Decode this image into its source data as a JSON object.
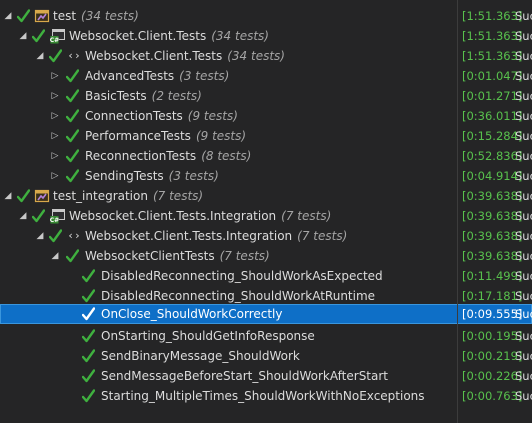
{
  "colors": {
    "background": "#252526",
    "selection": "#0e6fc7",
    "pass_green": "#3fb03f",
    "duration_green": "#58c14d",
    "text": "#dcdcdc",
    "count_text": "#a5a5a5"
  },
  "rows": [
    {
      "arrow": "expanded",
      "icon": "test-project-icon",
      "name": "test",
      "count": "(34 tests)",
      "duration": "[1:51.363]",
      "result": "Suc"
    },
    {
      "arrow": "expanded",
      "icon": "csharp-project-icon",
      "name": "Websocket.Client.Tests",
      "count": "(34 tests)",
      "duration": "[1:51.363]",
      "result": "Suc"
    },
    {
      "arrow": "expanded",
      "icon": "namespace-icon",
      "name": "Websocket.Client.Tests",
      "count": "(34 tests)",
      "duration": "[1:51.363]",
      "result": "Suc"
    },
    {
      "arrow": "collapsed",
      "icon": null,
      "name": "AdvancedTests",
      "count": "(3 tests)",
      "duration": "[0:01.047]",
      "result": "Suc"
    },
    {
      "arrow": "collapsed",
      "icon": null,
      "name": "BasicTests",
      "count": "(2 tests)",
      "duration": "[0:01.271]",
      "result": "Suc"
    },
    {
      "arrow": "collapsed",
      "icon": null,
      "name": "ConnectionTests",
      "count": "(9 tests)",
      "duration": "[0:36.011]",
      "result": "Suc"
    },
    {
      "arrow": "collapsed",
      "icon": null,
      "name": "PerformanceTests",
      "count": "(9 tests)",
      "duration": "[0:15.284]",
      "result": "Suc"
    },
    {
      "arrow": "collapsed",
      "icon": null,
      "name": "ReconnectionTests",
      "count": "(8 tests)",
      "duration": "[0:52.836]",
      "result": "Suc"
    },
    {
      "arrow": "collapsed",
      "icon": null,
      "name": "SendingTests",
      "count": "(3 tests)",
      "duration": "[0:04.914]",
      "result": "Suc"
    },
    {
      "arrow": "expanded",
      "icon": "test-project-icon",
      "name": "test_integration",
      "count": "(7 tests)",
      "duration": "[0:39.638]",
      "result": "Suc"
    },
    {
      "arrow": "expanded",
      "icon": "csharp-project-icon",
      "name": "Websocket.Client.Tests.Integration",
      "count": "(7 tests)",
      "duration": "[0:39.638]",
      "result": "Suc"
    },
    {
      "arrow": "expanded",
      "icon": "namespace-icon",
      "name": "Websocket.Client.Tests.Integration",
      "count": "(7 tests)",
      "duration": "[0:39.638]",
      "result": "Suc"
    },
    {
      "arrow": "expanded",
      "icon": null,
      "name": "WebsocketClientTests",
      "count": "(7 tests)",
      "duration": "[0:39.638]",
      "result": "Suc"
    },
    {
      "arrow": null,
      "icon": null,
      "name": "DisabledReconnecting_ShouldWorkAsExpected",
      "count": "",
      "duration": "[0:11.499]",
      "result": "Suc"
    },
    {
      "arrow": null,
      "icon": null,
      "name": "DisabledReconnecting_ShouldWorkAtRuntime",
      "count": "",
      "duration": "[0:17.181]",
      "result": "Suc"
    },
    {
      "arrow": null,
      "icon": null,
      "name": "OnClose_ShouldWorkCorrectly",
      "count": "",
      "duration": "[0:09.555]",
      "result": "Suc",
      "selected": true
    },
    {
      "arrow": null,
      "icon": null,
      "name": "OnStarting_ShouldGetInfoResponse",
      "count": "",
      "duration": "[0:00.195]",
      "result": "Suc"
    },
    {
      "arrow": null,
      "icon": null,
      "name": "SendBinaryMessage_ShouldWork",
      "count": "",
      "duration": "[0:00.219]",
      "result": "Suc"
    },
    {
      "arrow": null,
      "icon": null,
      "name": "SendMessageBeforeStart_ShouldWorkAfterStart",
      "count": "",
      "duration": "[0:00.226]",
      "result": "Suc"
    },
    {
      "arrow": null,
      "icon": null,
      "name": "Starting_MultipleTimes_ShouldWorkWithNoExceptions",
      "count": "",
      "duration": "[0:00.763]",
      "result": "Suc"
    }
  ]
}
